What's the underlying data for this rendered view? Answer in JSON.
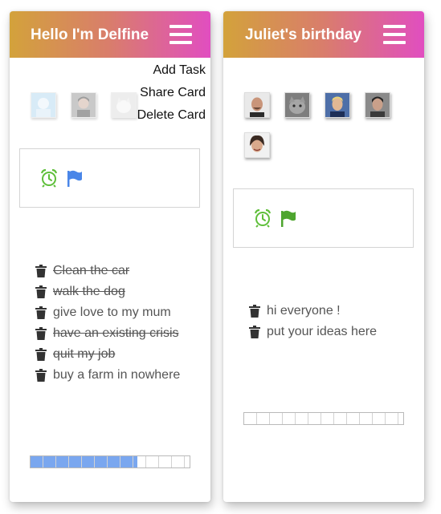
{
  "cards": [
    {
      "title": "Hello I'm Delfine",
      "menu": {
        "open": true,
        "items": [
          "Add Task",
          "Share Card",
          "Delete Card"
        ]
      },
      "members": [
        "baby",
        "man-dark-hair",
        "kitten"
      ],
      "tools": {
        "alarm_color": "#5fbf3a",
        "flag_color": "#4a86e8"
      },
      "tasks": [
        {
          "text": "Clean the car",
          "done": true
        },
        {
          "text": "walk the dog",
          "done": true
        },
        {
          "text": "give love to my mum",
          "done": false
        },
        {
          "text": "have an existing crisis",
          "done": true
        },
        {
          "text": "quit my job",
          "done": true
        },
        {
          "text": "buy a farm in nowhere",
          "done": false
        }
      ],
      "progress": 0.67
    },
    {
      "title": "Juliet's birthday",
      "menu": {
        "open": false,
        "items": []
      },
      "members": [
        "bald-man",
        "gray-cat",
        "blond-man",
        "dark-haired-man",
        "woman"
      ],
      "tools": {
        "alarm_color": "#5fbf3a",
        "flag_color": "#4ea52f"
      },
      "tasks": [
        {
          "text": "hi everyone !",
          "done": false
        },
        {
          "text": "put your ideas here",
          "done": false
        }
      ],
      "progress": 0
    }
  ],
  "icons": {
    "menu": "hamburger-menu-icon",
    "alarm": "alarm-clock-icon",
    "flag": "flag-icon",
    "trash": "trash-icon"
  }
}
